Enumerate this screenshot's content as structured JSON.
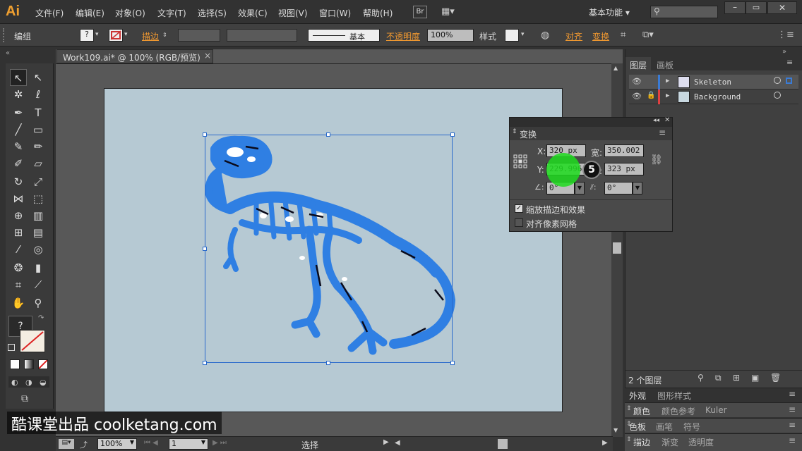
{
  "app": {
    "logo": "Ai"
  },
  "menu": [
    "文件(F)",
    "编辑(E)",
    "对象(O)",
    "文字(T)",
    "选择(S)",
    "效果(C)",
    "视图(V)",
    "窗口(W)",
    "帮助(H)"
  ],
  "bridge_label": "Br",
  "workspace": "基本功能",
  "control_bar": {
    "selection_type": "编组",
    "stroke_label": "描边",
    "stroke_style": "基本",
    "opacity_label": "不透明度",
    "opacity_value": "100%",
    "style_label": "样式",
    "align_label": "对齐",
    "transform_label": "变换"
  },
  "document": {
    "tab_title": "Work109.ai* @ 100% (RGB/预览)"
  },
  "status": {
    "zoom": "100%",
    "page": "1",
    "tool": "选择"
  },
  "layers_panel": {
    "tabs": [
      "图层",
      "画板"
    ],
    "layers": [
      {
        "name": "Skeleton",
        "color": "#3a7bd5"
      },
      {
        "name": "Background",
        "color": "#e04040"
      }
    ],
    "count": "2 个图层"
  },
  "transform_panel": {
    "title": "变换",
    "x_label": "X:",
    "x_value": "320 px",
    "width_label": "宽:",
    "width_value": "350.002 px",
    "y_label": "Y:",
    "y_value": "229.996",
    "height_label": "高:",
    "height_value": "323 px",
    "rotate_value": "0°",
    "shear_value": "0°",
    "scale_strokes": "缩放描边和效果",
    "align_pixel": "对齐像素网格",
    "step_badge": "5"
  },
  "side_panels": [
    {
      "tabs": [
        "外观",
        "图形样式"
      ]
    },
    {
      "tabs": [
        "颜色",
        "颜色参考",
        "Kuler"
      ]
    },
    {
      "tabs": [
        "色板",
        "画笔",
        "符号"
      ]
    },
    {
      "tabs": [
        "描边",
        "渐变",
        "透明度"
      ]
    }
  ],
  "toolbox": {
    "fill_stroke_label": "?"
  },
  "watermark": "酷课堂出品 coolketang.com"
}
